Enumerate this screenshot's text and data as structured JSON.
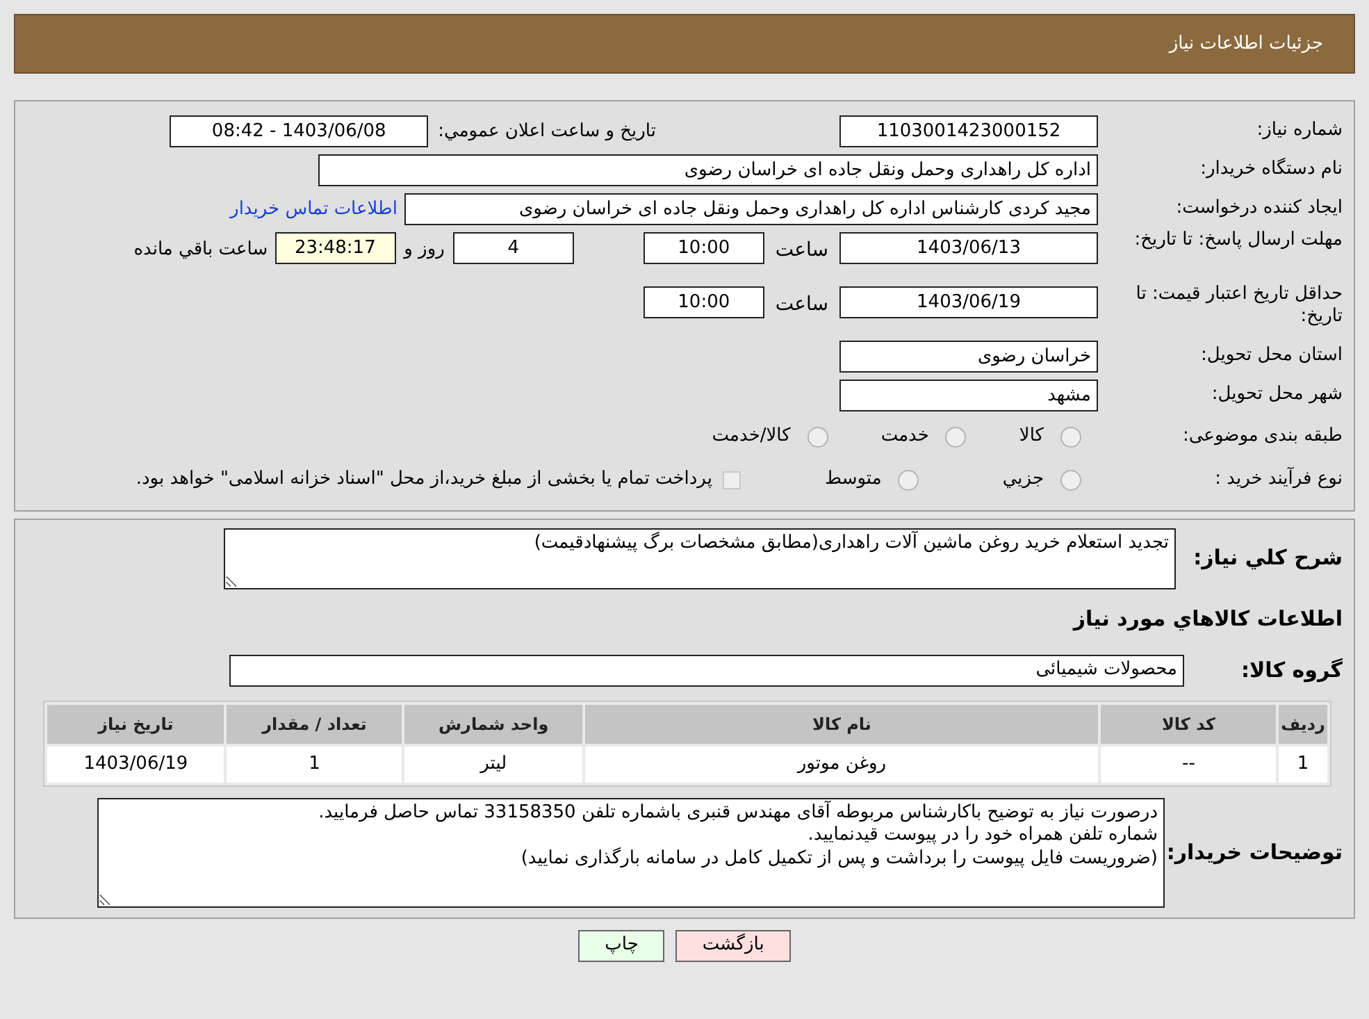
{
  "header": {
    "title": "جزئیات اطلاعات نیاز"
  },
  "need_number": {
    "label": "شماره نیاز:",
    "value": "1103001423000152"
  },
  "announce": {
    "label": "تاریخ و ساعت اعلان عمومي:",
    "value": "1403/06/08 - 08:42"
  },
  "buyer_org": {
    "label": "نام دستگاه خریدار:",
    "value": "اداره کل راهداری وحمل ونقل جاده ای خراسان رضوی"
  },
  "requester": {
    "label": "ایجاد کننده درخواست:",
    "value": "مجید کردی کارشناس اداره کل راهداری وحمل ونقل جاده ای خراسان رضوی",
    "link": "اطلاعات تماس خریدار"
  },
  "reply_deadline": {
    "label": "مهلت ارسال پاسخ: تا تاریخ:",
    "date": "1403/06/13",
    "time_label": "ساعت",
    "time": "10:00",
    "days": "4",
    "days_label": "روز و",
    "remaining": "23:48:17",
    "remaining_label": "ساعت باقي مانده"
  },
  "price_validity": {
    "label": "حداقل تاریخ اعتبار قیمت: تا تاریخ:",
    "date": "1403/06/19",
    "time_label": "ساعت",
    "time": "10:00"
  },
  "province": {
    "label": "استان محل تحویل:",
    "value": "خراسان رضوی"
  },
  "city": {
    "label": "شهر محل تحویل:",
    "value": "مشهد"
  },
  "category": {
    "label": "طبقه بندی موضوعی:",
    "options": [
      {
        "label": "کالا",
        "selected": false
      },
      {
        "label": "خدمت",
        "selected": false
      },
      {
        "label": "کالا/خدمت",
        "selected": false
      }
    ]
  },
  "purchase_type": {
    "label": "نوع فرآیند خرید :",
    "options": [
      {
        "kind": "radio",
        "label": "جزيي",
        "selected": false
      },
      {
        "kind": "radio",
        "label": "متوسط",
        "selected": false
      },
      {
        "kind": "checkbox",
        "label": "پرداخت تمام یا بخشی از مبلغ خرید،از محل \"اسناد خزانه اسلامی\" خواهد بود.",
        "checked": false
      }
    ]
  },
  "description": {
    "label": "شرح كلي نياز:",
    "value": "تجدید استعلام خرید روغن ماشین آلات راهداری(مطابق مشخصات برگ پیشنهادقیمت)"
  },
  "goods_heading": "اطلاعات كالاهاي مورد نياز",
  "goods_group": {
    "label": "گروه كالا:",
    "value": "محصولات شیمیائی"
  },
  "table": {
    "columns": [
      "ردیف",
      "کد کالا",
      "نام کالا",
      "واحد شمارش",
      "تعداد / مقدار",
      "تاریخ نیاز"
    ],
    "rows": [
      [
        "1",
        "--",
        "روغن موتور",
        "لیتر",
        "1",
        "1403/06/19"
      ]
    ]
  },
  "buyer_notes": {
    "label": "توضیحات خریدار:",
    "lines": [
      "درصورت نیاز به توضیح باکارشناس مربوطه آقای مهندس قنبری باشماره تلفن 33158350 تماس حاصل فرمایید.",
      "شماره تلفن همراه خود را در پیوست قیدنمایید.",
      "(ضروریست فایل پیوست را برداشت و پس از تکمیل کامل در سامانه بارگذاری نمایید)"
    ]
  },
  "buttons": [
    {
      "kind": "back",
      "label": "بازگشت"
    },
    {
      "kind": "print",
      "label": "چاپ"
    }
  ]
}
